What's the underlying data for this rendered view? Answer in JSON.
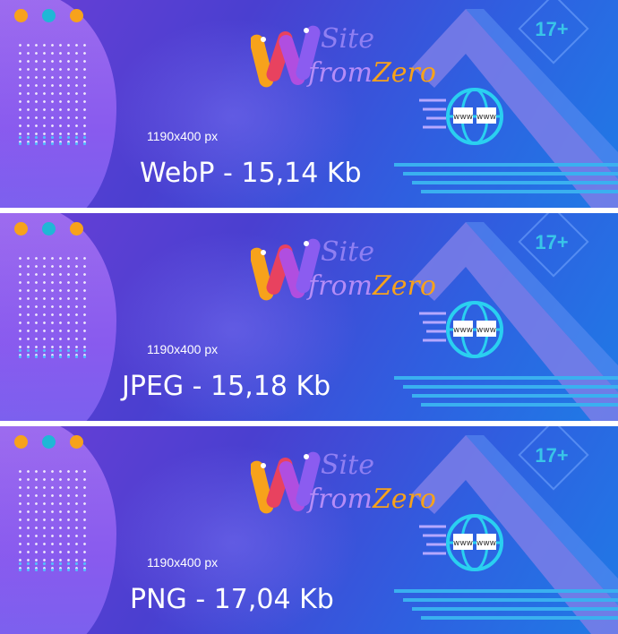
{
  "banners": [
    {
      "name": "webp",
      "dimensions": "1190x400 px",
      "label": "WebP - 15,14 Kb"
    },
    {
      "name": "jpeg",
      "dimensions": "1190x400 px",
      "label": "JPEG - 15,18 Kb"
    },
    {
      "name": "png",
      "dimensions": "1190x400 px",
      "label": "PNG - 17,04 Kb"
    }
  ],
  "logo": {
    "line1": "Site",
    "line2_from": "from",
    "line2_zero": "Zero"
  },
  "badge": "17+",
  "colors": {
    "orange": "#f7a21b",
    "cyan": "#1fb7d6",
    "purple": "#8b5cf0",
    "blue": "#1f7be6"
  },
  "icons": [
    "globe-www-icon",
    "w-logo-icon"
  ]
}
